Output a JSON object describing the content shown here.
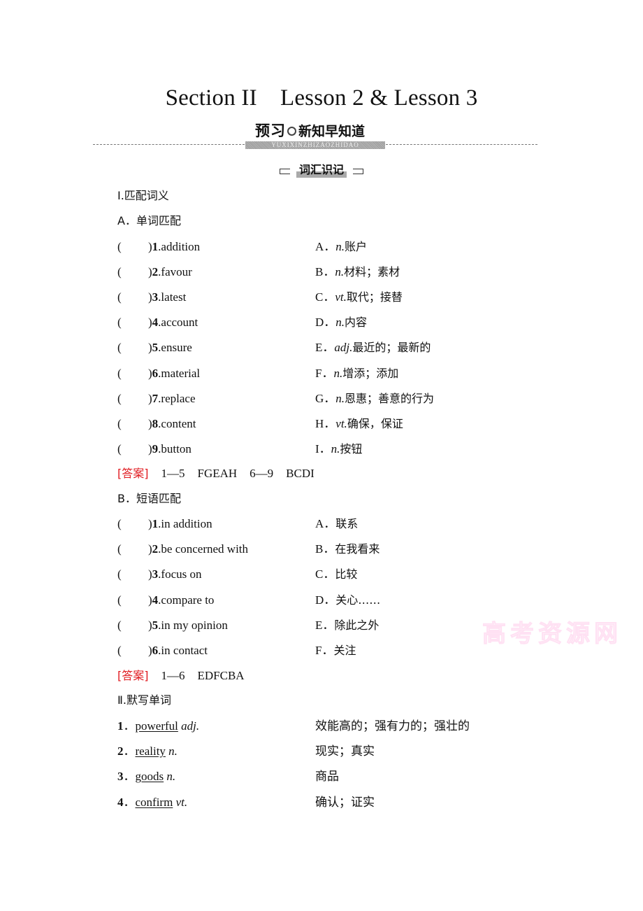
{
  "title": "Section II　Lesson 2 & Lesson 3",
  "banner": {
    "head_bold": "预习",
    "head_text": "新知早知道",
    "pinyin": "YUXIXINZHIZAOZHIDAO"
  },
  "subhead": "词汇识记",
  "part1": {
    "heading": "Ⅰ.匹配词义",
    "sectionA": {
      "heading": "A．单词匹配",
      "items": [
        {
          "num": "1",
          "word": "addition",
          "opt": "A．",
          "pos": "n.",
          "meaning": "账户"
        },
        {
          "num": "2",
          "word": "favour",
          "opt": "B．",
          "pos": "n.",
          "meaning": "材料；素材"
        },
        {
          "num": "3",
          "word": "latest",
          "opt": "C．",
          "pos": "vt.",
          "meaning": "取代；接替"
        },
        {
          "num": "4",
          "word": "account",
          "opt": "D．",
          "pos": "n.",
          "meaning": "内容"
        },
        {
          "num": "5",
          "word": "ensure",
          "opt": "E．",
          "pos": "adj.",
          "meaning": "最近的；最新的"
        },
        {
          "num": "6",
          "word": "material",
          "opt": "F．",
          "pos": "n.",
          "meaning": "增添；添加"
        },
        {
          "num": "7",
          "word": "replace",
          "opt": "G．",
          "pos": "n.",
          "meaning": "恩惠；善意的行为"
        },
        {
          "num": "8",
          "word": "content",
          "opt": "H．",
          "pos": "vt.",
          "meaning": "确保，保证"
        },
        {
          "num": "9",
          "word": "button",
          "opt": "I．",
          "pos": "n.",
          "meaning": "按钮"
        }
      ],
      "answer": {
        "tag": "[答案]",
        "parts": [
          "1—5",
          "FGEAH",
          "6—9",
          "BCDI"
        ]
      }
    },
    "sectionB": {
      "heading": "B．短语匹配",
      "items": [
        {
          "num": "1",
          "phrase": "in addition",
          "opt": "A．",
          "meaning": "联系"
        },
        {
          "num": "2",
          "phrase": "be concerned with",
          "opt": "B．",
          "meaning": "在我看来"
        },
        {
          "num": "3",
          "phrase": "focus on",
          "opt": "C．",
          "meaning": "比较"
        },
        {
          "num": "4",
          "phrase": "compare to",
          "opt": "D．",
          "meaning": "关心……"
        },
        {
          "num": "5",
          "phrase": "in my opinion",
          "opt": "E．",
          "meaning": "除此之外"
        },
        {
          "num": "6",
          "phrase": "in contact",
          "opt": "F．",
          "meaning": "关注"
        }
      ],
      "answer": {
        "tag": "[答案]",
        "parts": [
          "1—6",
          "EDFCBA"
        ]
      }
    }
  },
  "part2": {
    "heading": "Ⅱ.默写单词",
    "items": [
      {
        "num": "1",
        "word": "powerful",
        "pos": "adj.",
        "meaning": "效能高的；强有力的；强壮的"
      },
      {
        "num": "2",
        "word": "reality",
        "pos": "n.",
        "meaning": "现实；真实"
      },
      {
        "num": "3",
        "word": "goods",
        "pos": "n.",
        "meaning": "商品"
      },
      {
        "num": "4",
        "word": "confirm",
        "pos": "vt.",
        "meaning": "确认；证实"
      }
    ]
  },
  "watermark": "高考资源网"
}
